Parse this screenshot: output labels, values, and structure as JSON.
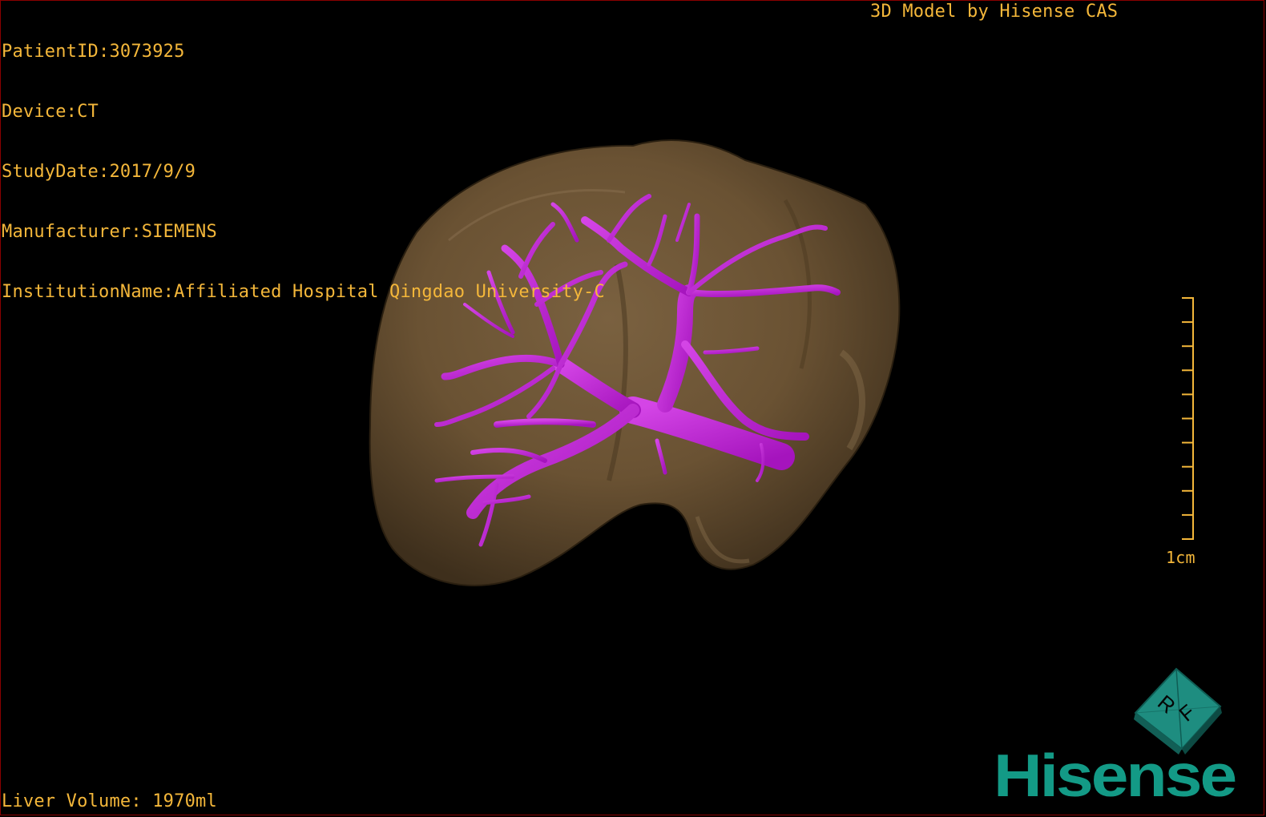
{
  "header": {
    "patient_id": "PatientID:3073925",
    "device": "Device:CT",
    "study_date": "StudyDate:2017/9/9",
    "manufacturer": "Manufacturer:SIEMENS",
    "institution": "InstitutionName:Affiliated Hospital Qingdao University-C",
    "credit": "3D Model by Hisense CAS"
  },
  "footer": {
    "volume": "Liver Volume: 1970ml"
  },
  "scale": {
    "label": "1cm",
    "ticks": 10
  },
  "orientation_cube": {
    "face_labels": [
      "R",
      "F"
    ],
    "color": "#1e8d80"
  },
  "brand": {
    "logo_text": "Hisense",
    "color": "#139a86"
  },
  "colors": {
    "overlay_text": "#f4b73a",
    "liver": "#6b5334",
    "vessels": "#c21ed8",
    "background": "#000000"
  },
  "icons": {
    "liver_model": "liver-3d-model",
    "vessel_tree": "portal-vein-tree"
  }
}
